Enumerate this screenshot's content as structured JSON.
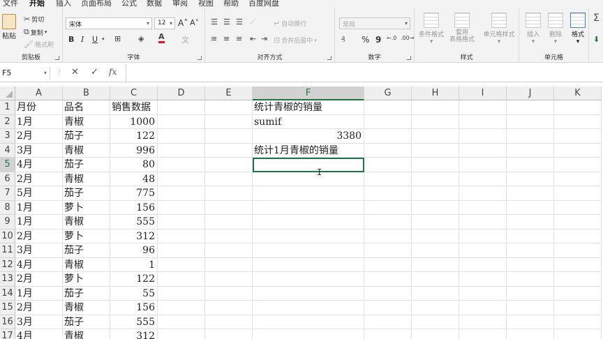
{
  "menu": {
    "tabs": [
      "文件",
      "开始",
      "插入",
      "页面布局",
      "公式",
      "数据",
      "审阅",
      "视图",
      "帮助",
      "百度网盘"
    ],
    "active": "开始"
  },
  "ribbon": {
    "clipboard": {
      "paste": "粘贴",
      "cut": "剪切",
      "copy": "复制",
      "format_painter": "格式刷",
      "label": "剪贴板"
    },
    "font": {
      "name": "宋体",
      "size": "12",
      "bold": "B",
      "italic": "I",
      "underline": "U",
      "grow": "A˄",
      "shrink": "A˅",
      "label": "字体",
      "font_color": "#e81123"
    },
    "alignment": {
      "wrap": "自动换行",
      "merge": "合并后居中",
      "label": "对齐方式"
    },
    "number": {
      "format": "常规",
      "percent": "%",
      "comma": "9",
      "label": "数字"
    },
    "styles": {
      "conditional": "条件格式",
      "table": "套用\n表格格式",
      "cell_styles": "单元格样式",
      "label": "样式"
    },
    "cells": {
      "insert": "插入",
      "delete": "删除",
      "format": "格式",
      "label": "单元格"
    }
  },
  "formula_bar": {
    "name_box": "F5",
    "cancel": "✕",
    "enter": "✓",
    "fx": "fx",
    "value": ""
  },
  "grid": {
    "columns": [
      "A",
      "B",
      "C",
      "D",
      "E",
      "F",
      "G",
      "H",
      "I",
      "J",
      "K"
    ],
    "selected_column": "F",
    "selected_row": "5",
    "rows": [
      {
        "n": "1",
        "A": "月份",
        "B": "品名",
        "C": "销售数据",
        "F": "统计青椒的销量"
      },
      {
        "n": "2",
        "A": "1月",
        "B": "青椒",
        "C": "1000",
        "F": "sumif"
      },
      {
        "n": "3",
        "A": "2月",
        "B": "茄子",
        "C": "122",
        "F": "3380"
      },
      {
        "n": "4",
        "A": "3月",
        "B": "青椒",
        "C": "996",
        "F": "统计1月青椒的销量"
      },
      {
        "n": "5",
        "A": "4月",
        "B": "茄子",
        "C": "80",
        "F": ""
      },
      {
        "n": "6",
        "A": "2月",
        "B": "青椒",
        "C": "48",
        "F": ""
      },
      {
        "n": "7",
        "A": "5月",
        "B": "茄子",
        "C": "775",
        "F": ""
      },
      {
        "n": "8",
        "A": "1月",
        "B": "萝卜",
        "C": "156",
        "F": ""
      },
      {
        "n": "9",
        "A": "1月",
        "B": "青椒",
        "C": "555",
        "F": ""
      },
      {
        "n": "10",
        "A": "2月",
        "B": "萝卜",
        "C": "312",
        "F": ""
      },
      {
        "n": "11",
        "A": "3月",
        "B": "茄子",
        "C": "96",
        "F": ""
      },
      {
        "n": "12",
        "A": "4月",
        "B": "青椒",
        "C": "1",
        "F": ""
      },
      {
        "n": "13",
        "A": "2月",
        "B": "萝卜",
        "C": "122",
        "F": ""
      },
      {
        "n": "14",
        "A": "1月",
        "B": "茄子",
        "C": "55",
        "F": ""
      },
      {
        "n": "15",
        "A": "2月",
        "B": "青椒",
        "C": "156",
        "F": ""
      },
      {
        "n": "16",
        "A": "3月",
        "B": "茄子",
        "C": "555",
        "F": ""
      },
      {
        "n": "17",
        "A": "4月",
        "B": "青椒",
        "C": "312",
        "F": ""
      }
    ]
  },
  "accent_color": "#217346",
  "mouse_cursor": "I"
}
